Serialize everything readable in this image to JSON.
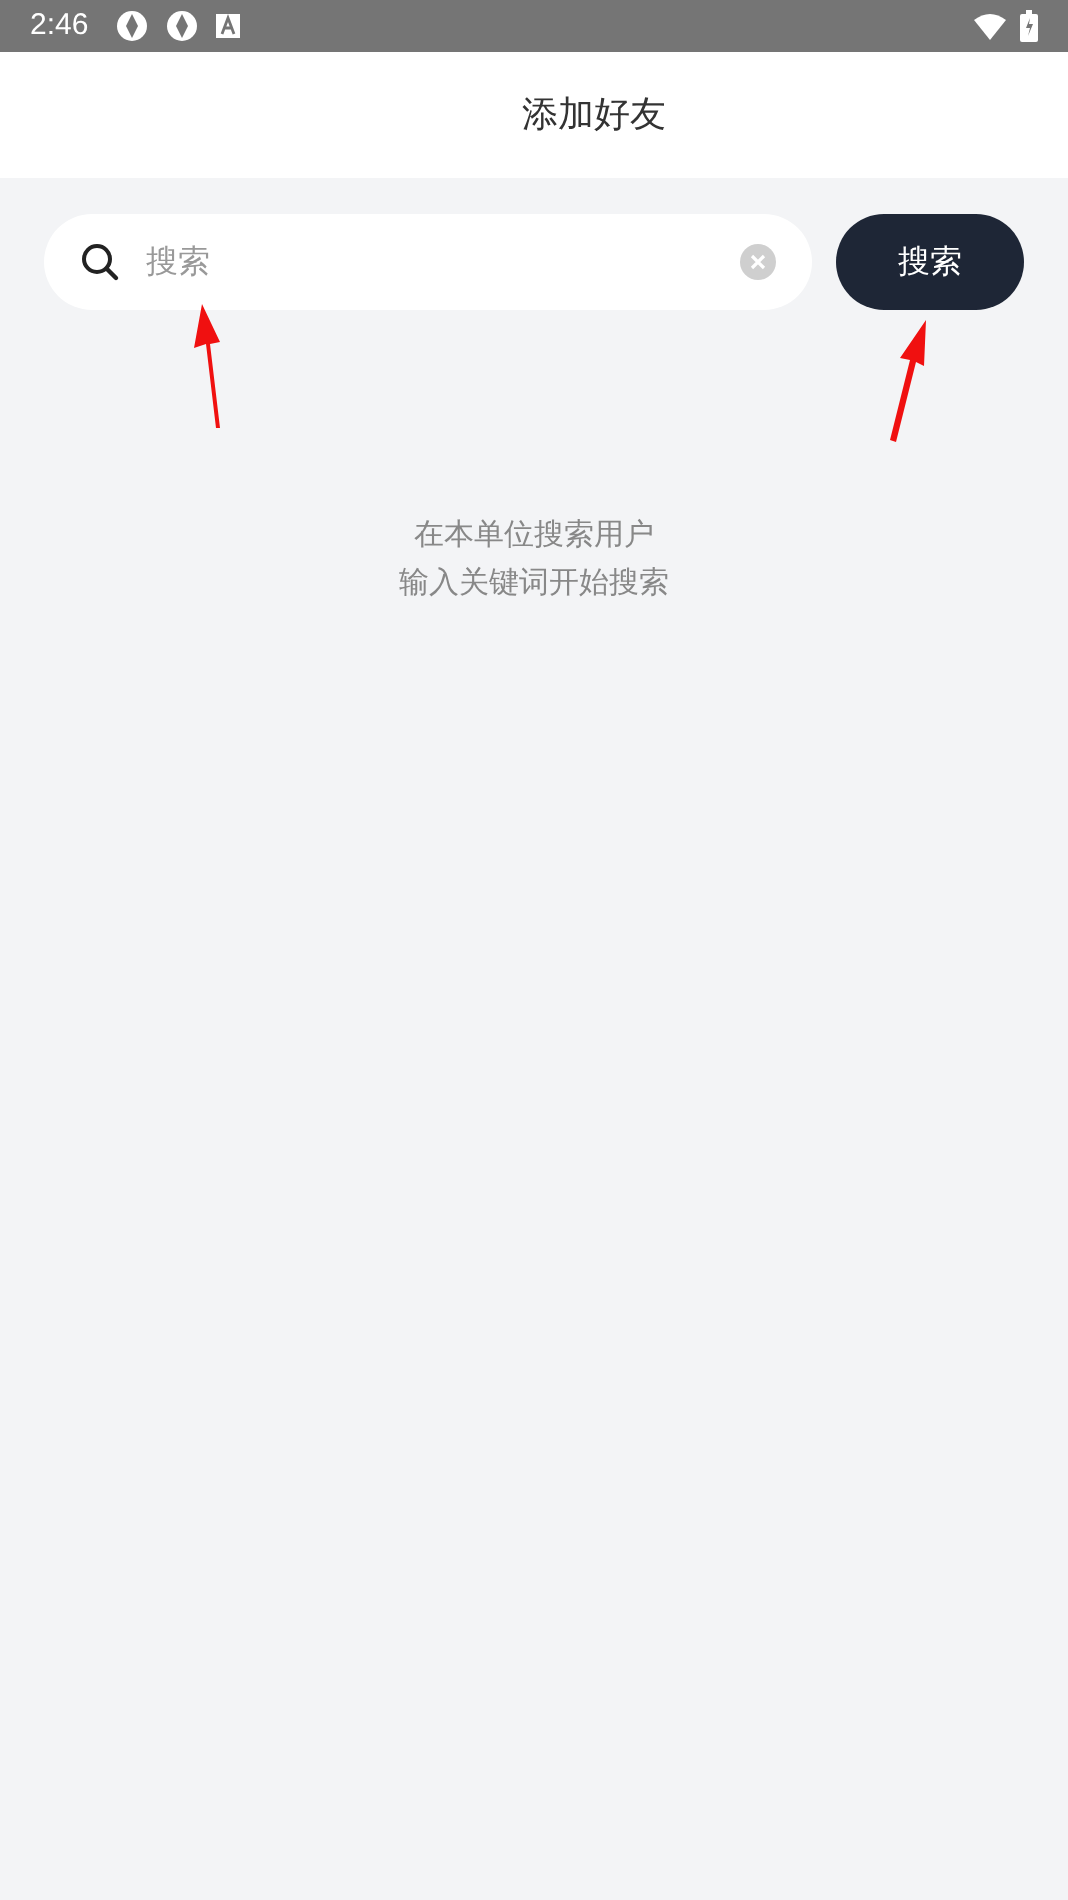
{
  "status_bar": {
    "time": "2:46"
  },
  "header": {
    "title": "添加好友"
  },
  "search": {
    "placeholder": "搜索",
    "button": "搜索"
  },
  "hint": [
    "在本单位搜索用户",
    "输入关键词开始搜索"
  ]
}
